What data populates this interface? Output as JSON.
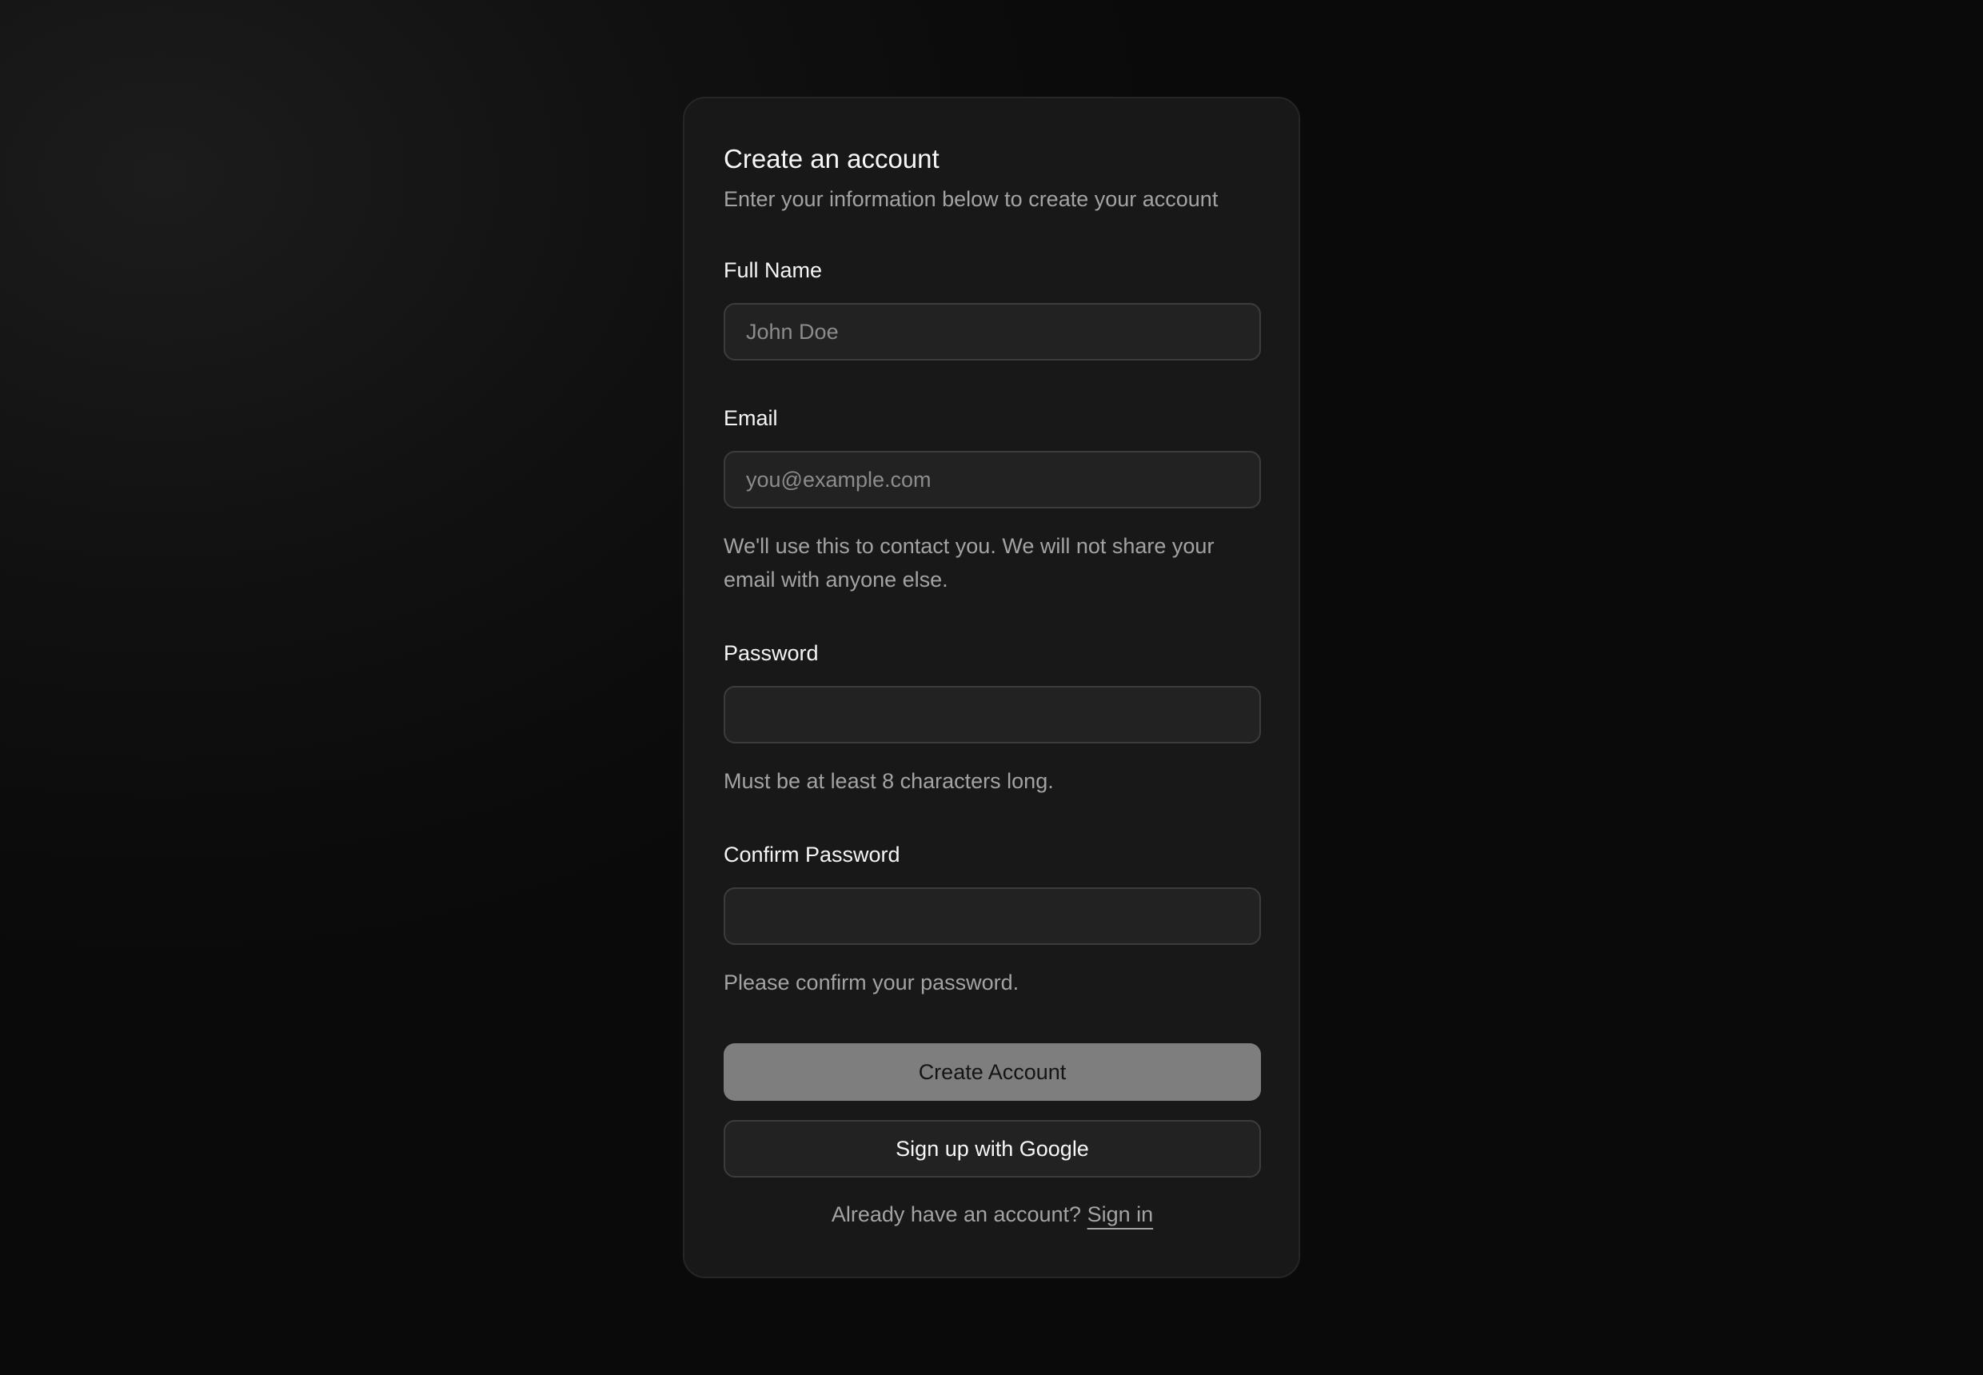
{
  "card": {
    "title": "Create an account",
    "subtitle": "Enter your information below to create your account"
  },
  "fields": {
    "full_name": {
      "label": "Full Name",
      "placeholder": "John Doe",
      "value": ""
    },
    "email": {
      "label": "Email",
      "placeholder": "you@example.com",
      "value": "",
      "help": "We'll use this to contact you. We will not share your email with anyone else."
    },
    "password": {
      "label": "Password",
      "value": "",
      "help": "Must be at least 8 characters long."
    },
    "confirm_password": {
      "label": "Confirm Password",
      "value": "",
      "help": "Please confirm your password."
    }
  },
  "actions": {
    "create_account_label": "Create Account",
    "google_label": "Sign up with Google"
  },
  "footer": {
    "prompt": "Already have an account? ",
    "link_label": "Sign in"
  },
  "colors": {
    "background": "#0b0b0b",
    "card": "#181818",
    "primary_button": "#7e7e7e",
    "muted_text": "#a3a3a3"
  }
}
